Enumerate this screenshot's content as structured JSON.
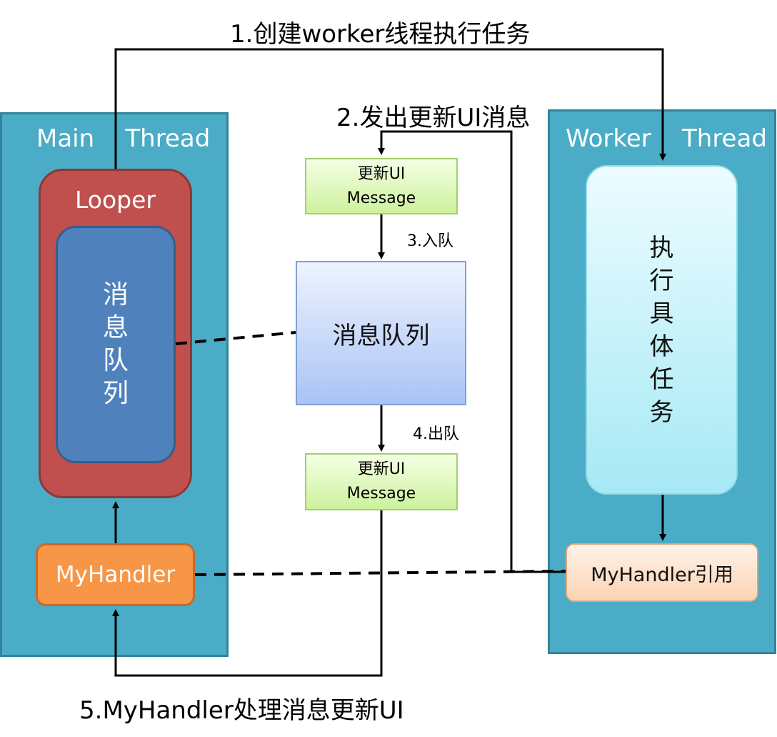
{
  "main_thread": {
    "title": "Main    Thread",
    "looper_label": "Looper",
    "inner_queue_text": "消息队列",
    "handler_label": "MyHandler"
  },
  "center": {
    "top_message": "更新UI\nMessage",
    "queue_label": "消息队列",
    "bottom_message": "更新UI\nMessage"
  },
  "worker_thread": {
    "title": "Worker    Thread",
    "task_text": "执行具体任务",
    "handler_ref_label": "MyHandler引用"
  },
  "steps": {
    "step1": "1.创建worker线程执行任务",
    "step2": "2.发出更新UI消息",
    "step3": "3.入队",
    "step4": "4.出队",
    "step5": "5.MyHandler处理消息更新UI"
  },
  "colors": {
    "panel": "#4aacc6",
    "looper": "#c0504d",
    "inner_queue": "#4f81bd",
    "handler": "#f79646"
  }
}
